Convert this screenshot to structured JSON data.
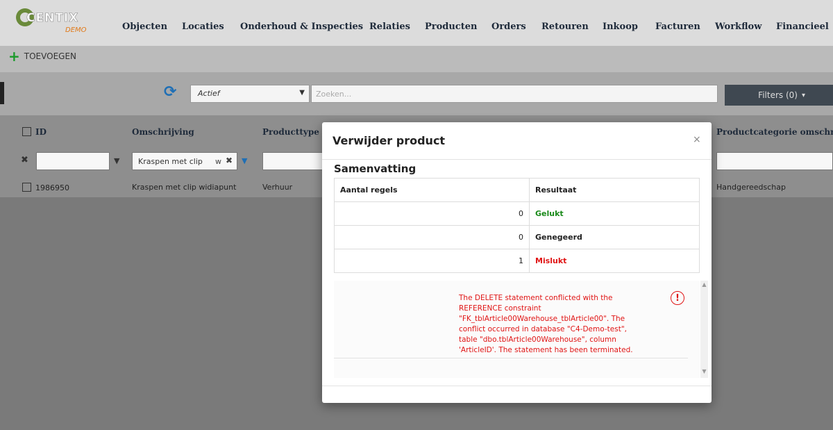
{
  "app": {
    "logo_text": "CENTIX",
    "logo_sub": "DEMO"
  },
  "nav": [
    {
      "label": "Objecten"
    },
    {
      "label": "Locaties"
    },
    {
      "label": "Onderhoud & Inspecties"
    },
    {
      "label": "Relaties"
    },
    {
      "label": "Producten"
    },
    {
      "label": "Orders"
    },
    {
      "label": "Retouren"
    },
    {
      "label": "Inkoop"
    },
    {
      "label": "Facturen"
    },
    {
      "label": "Workflow"
    },
    {
      "label": "Financieel"
    }
  ],
  "toolbar": {
    "add_label": "TOEVOEGEN",
    "add_icon": "plus-icon"
  },
  "filters": {
    "status_value": "Actief",
    "search_placeholder": "Zoeken...",
    "filters_label": "Filters (0)",
    "filters_caret": "▾"
  },
  "grid": {
    "headers": {
      "id": "ID",
      "omschrijving": "Omschrijving",
      "producttype": "Producttype",
      "productcategorie": "Productcategorie omschrijving"
    },
    "filter_omschrijving": "Kraspen met clip",
    "filter_omschrijving_suffix": "w",
    "row": {
      "id": "1986950",
      "omschrijving": "Kraspen met clip widiapunt",
      "producttype": "Verhuur",
      "productcategorie": "Handgereedschap"
    }
  },
  "modal": {
    "title": "Verwijder product",
    "close": "×",
    "subtitle": "Samenvatting",
    "table": {
      "col_count": "Aantal regels",
      "col_result": "Resultaat",
      "rows": [
        {
          "count": "0",
          "result": "Gelukt"
        },
        {
          "count": "0",
          "result": "Genegeerd"
        },
        {
          "count": "1",
          "result": "Mislukt"
        }
      ]
    },
    "error_message": "The DELETE statement conflicted with the REFERENCE constraint \"FK_tblArticle00Warehouse_tblArticle00\". The conflict occurred in database \"C4-Demo-test\", table \"dbo.tblArticle00Warehouse\", column 'ArticleID'. The statement has been terminated.",
    "error_icon": "!"
  },
  "colors": {
    "success": "#1a8a1a",
    "failure": "#e01414",
    "accent": "#1f6fb5"
  }
}
